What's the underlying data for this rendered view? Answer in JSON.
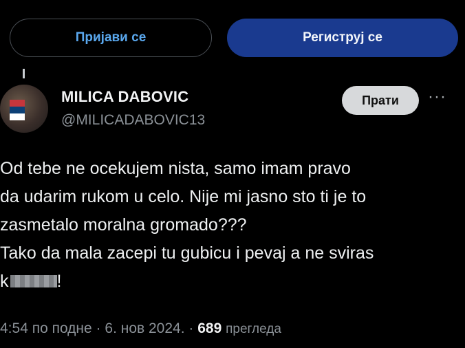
{
  "auth": {
    "login_label": "Пријави се",
    "register_label": "Региструј се"
  },
  "author": {
    "name": "MILICA DABOVIC",
    "handle": "@MILICADABOVIC13",
    "follow_label": "Прати",
    "more_label": "···"
  },
  "tweet": {
    "lines": [
      "Od tebe ne ocekujem nista, samo imam pravo",
      "da udarim rukom u celo. Nije mi jasno sto ti je to",
      "zasmetalo moralna gromado???",
      "Tako da mala zacepi tu gubicu i pevaj a ne sviras"
    ],
    "last_line_prefix": "k",
    "last_line_suffix": "!"
  },
  "meta": {
    "time": "4:54 по подне",
    "sep1": " · ",
    "date": "6. нов 2024.",
    "sep2": " · ",
    "views_count": "689",
    "views_label": "прегледа"
  },
  "colors": {
    "background": "#000000",
    "register_button": "#1a3a8f",
    "login_text": "#5aa8ee",
    "follow_button": "#d7d9db",
    "secondary_text": "#8b9197"
  }
}
